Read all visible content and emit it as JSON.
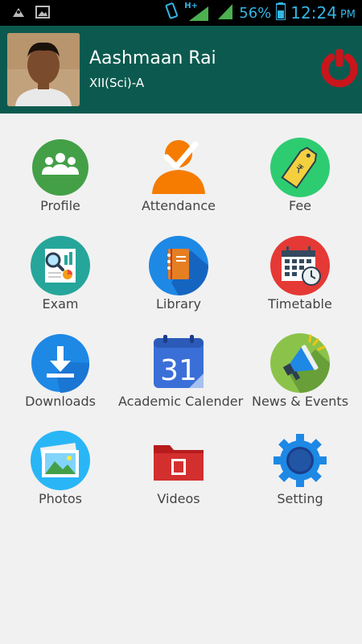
{
  "status": {
    "battery": "56%",
    "time": "12:24",
    "ampm": "PM",
    "network": "H+"
  },
  "profile": {
    "name": "Aashmaan Rai",
    "class": "XII(Sci)-A"
  },
  "menu": [
    {
      "label": "Profile",
      "icon": "profile-icon",
      "color": "#43a047"
    },
    {
      "label": "Attendance",
      "icon": "attendance-icon",
      "color": "#f57c00"
    },
    {
      "label": "Fee",
      "icon": "fee-tag-icon",
      "color": "#2ecc71"
    },
    {
      "label": "Exam",
      "icon": "exam-report-icon",
      "color": "#26a69a"
    },
    {
      "label": "Library",
      "icon": "library-book-icon",
      "color": "#1e88e5"
    },
    {
      "label": "Timetable",
      "icon": "timetable-calendar-icon",
      "color": "#e53935"
    },
    {
      "label": "Downloads",
      "icon": "download-icon",
      "color": "#1e88e5"
    },
    {
      "label": "Academic Calender",
      "icon": "calendar-31-icon",
      "color": "#3b6fd8"
    },
    {
      "label": "News & Events",
      "icon": "megaphone-icon",
      "color": "#8bc34a"
    },
    {
      "label": "Photos",
      "icon": "photos-icon",
      "color": "#29b6f6"
    },
    {
      "label": "Videos",
      "icon": "video-folder-icon",
      "color": "#d32f2f"
    },
    {
      "label": "Setting",
      "icon": "settings-gear-icon",
      "color": "#1565c0"
    }
  ],
  "calendar_day": "31"
}
